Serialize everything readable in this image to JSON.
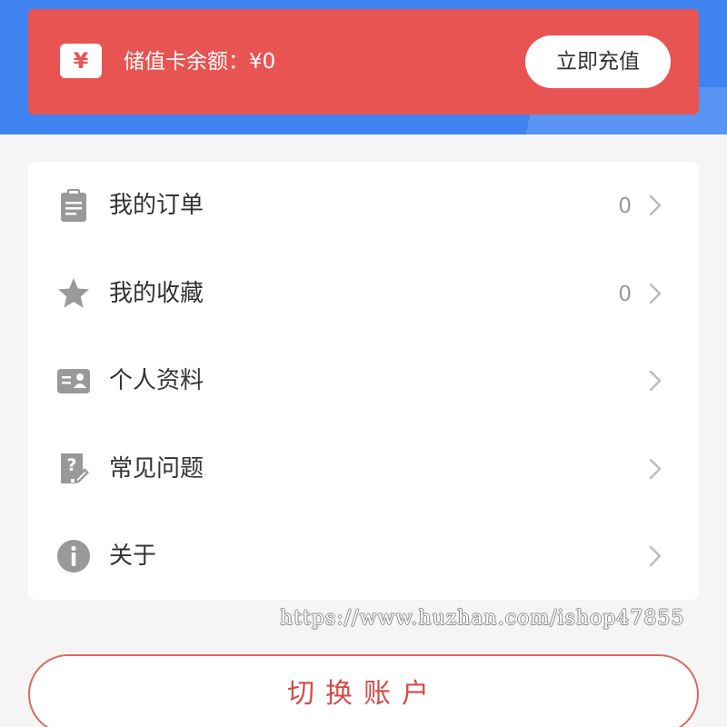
{
  "balance_card": {
    "icon": "yen-icon",
    "icon_glyph": "¥",
    "label": "储值卡余额：¥0",
    "recharge_label": "立即充值"
  },
  "menu": {
    "items": [
      {
        "icon": "clipboard-icon",
        "label": "我的订单",
        "count": "0"
      },
      {
        "icon": "star-icon",
        "label": "我的收藏",
        "count": "0"
      },
      {
        "icon": "id-card-icon",
        "label": "个人资料"
      },
      {
        "icon": "question-icon",
        "label": "常见问题"
      },
      {
        "icon": "info-icon",
        "label": "关于"
      }
    ]
  },
  "watermark": "https://www.huzhan.com/ishop47855",
  "switch_account_label": "切换账户",
  "colors": {
    "header_blue": "#3f82f0",
    "card_red": "#e75452",
    "icon_gray": "#999999",
    "button_red": "#d14c49"
  }
}
